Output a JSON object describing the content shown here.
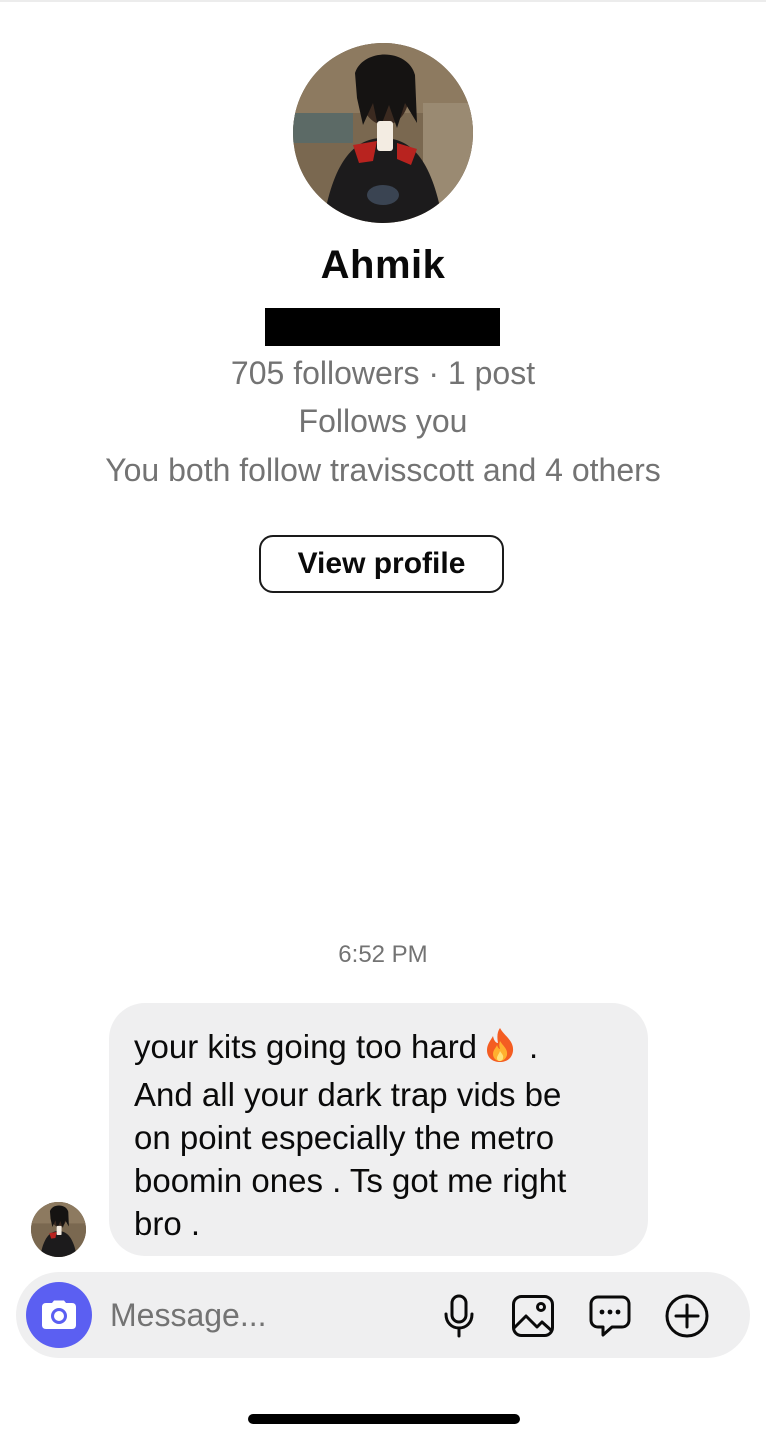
{
  "profile": {
    "name": "Ahmik",
    "followers_line": "705 followers · 1 post",
    "follows_you": "Follows you",
    "mutual_line": "You both follow travisscott and 4 others",
    "view_profile_label": "View profile"
  },
  "conversation": {
    "timestamp": "6:52 PM",
    "messages": [
      {
        "lines": [
          "your kits going too hard",
          ".",
          "And all your dark trap vids be",
          "on point especially the metro",
          "boomin ones . Ts got me right",
          "bro ."
        ],
        "emoji": "fire-emoji"
      }
    ]
  },
  "composer": {
    "placeholder": "Message...",
    "camera_icon": "camera-icon",
    "icons": [
      "microphone-icon",
      "gallery-icon",
      "sticker-icon",
      "plus-icon"
    ],
    "accent_color": "#5b5ff2"
  },
  "colors": {
    "bubble_background": "#efeff0",
    "secondary_text": "#737373",
    "primary_text": "#0a0a0a"
  }
}
